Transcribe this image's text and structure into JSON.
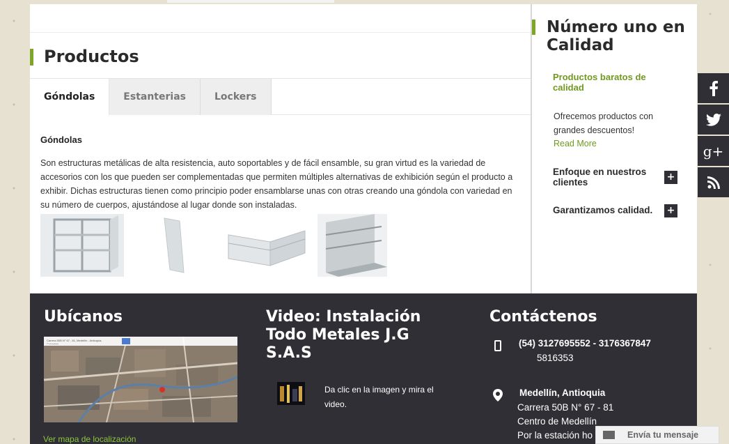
{
  "main": {
    "title": "Productos",
    "tabs": [
      {
        "label": "Góndolas"
      },
      {
        "label": "Estanterias"
      },
      {
        "label": "Lockers"
      }
    ],
    "content": {
      "heading": "Góndolas",
      "body": "Son estructuras metálicas de alta resistencia, auto soportables y de fácil ensamble, su gran virtud es la variedad de accesorios con los que pueden ser complementadas que permiten múltiples alternativas de exhibición según el producto a exhibir. Dichas estructuras tienen como principio poder ensamblarse unas con otras creando una góndola con variedad en su número de cuerpos, ajustándose al lugar donde son instaladas."
    }
  },
  "sidebar": {
    "title": "Número uno en Calidad",
    "accordion_open": {
      "title": "Productos baratos de calidad",
      "text": "Ofrecemos productos con grandes descuentos!",
      "read_more": "Read More"
    },
    "accordion_items": [
      {
        "label": "Enfoque en nuestros clientes",
        "toggle": "+"
      },
      {
        "label": "Garantizamos calidad.",
        "toggle": "+"
      }
    ]
  },
  "social": [
    "facebook-icon",
    "twitter-icon",
    "google-plus-icon",
    "rss-icon"
  ],
  "footer": {
    "location": {
      "title": "Ubícanos",
      "map_bar_text": "Carrera 50B N° 67 - 81, Medellín - Antioquia, Colombia",
      "link": "Ver mapa de localización"
    },
    "video": {
      "title": "Video: Instalación Todo Metales J.G S.A.S",
      "text": "Da clic en la imagen y mira el video."
    },
    "contact": {
      "title": "Contáctenos",
      "phone_main": "(54) 3127695552 - 3176367847",
      "phone_alt": "5816353",
      "city": "Medellín, Antioquia",
      "address_lines": [
        "Carrera 50B N° 67 - 81",
        "Centro de Medellín",
        "Por la estación ho"
      ]
    }
  },
  "chat": {
    "label": "Envía tu mensaje"
  },
  "colors": {
    "accent": "#7da628",
    "dark": "#2f2f35",
    "link_green": "#8cc63f"
  }
}
